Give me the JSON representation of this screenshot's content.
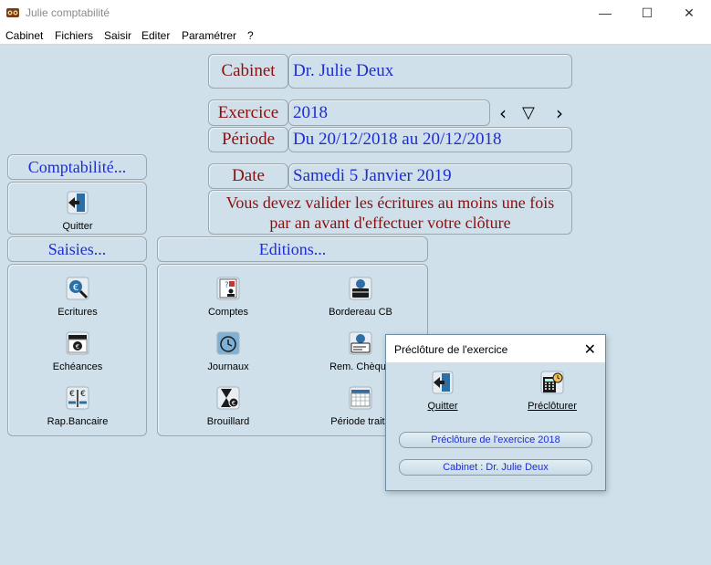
{
  "window": {
    "title": "Julie comptabilité",
    "minimize": "—",
    "maximize": "☐",
    "close": "✕"
  },
  "menu": [
    "Cabinet",
    "Fichiers",
    "Saisir",
    "Editer",
    "Paramétrer",
    "?"
  ],
  "header": {
    "cabinet_label": "Cabinet",
    "cabinet_value": "Dr. Julie Deux",
    "exercice_label": "Exercice",
    "exercice_value": "2018",
    "periode_label": "Période",
    "periode_value": "Du 20/12/2018 au 20/12/2018",
    "date_label": "Date",
    "date_value": "Samedi 5 Janvier 2019",
    "message": "Vous devez valider les écritures au moins une fois par an avant d'effectuer votre clôture",
    "nav_prev": "‹",
    "nav_down": "▽",
    "nav_next": "›"
  },
  "comptabilite": {
    "title": "Comptabilité...",
    "quit": "Quitter"
  },
  "saisies": {
    "title": "Saisies...",
    "items": [
      "Ecritures",
      "Echéances",
      "Rap.Bancaire"
    ]
  },
  "editions": {
    "title": "Editions...",
    "left": [
      "Comptes",
      "Journaux",
      "Brouillard"
    ],
    "right": [
      "Bordereau CB",
      "Rem. Chèque",
      "Période traité"
    ]
  },
  "dialog": {
    "title": "Préclôture de l'exercice",
    "close": "✕",
    "quit": "Quitter",
    "precloturer": "Préclôturer",
    "btn1": "Préclôture de l'exercice 2018",
    "btn2": "Cabinet : Dr. Julie Deux"
  },
  "colors": {
    "background": "#cfe0ea",
    "label_red": "#8b0f0f",
    "value_blue": "#1d2dd0"
  }
}
